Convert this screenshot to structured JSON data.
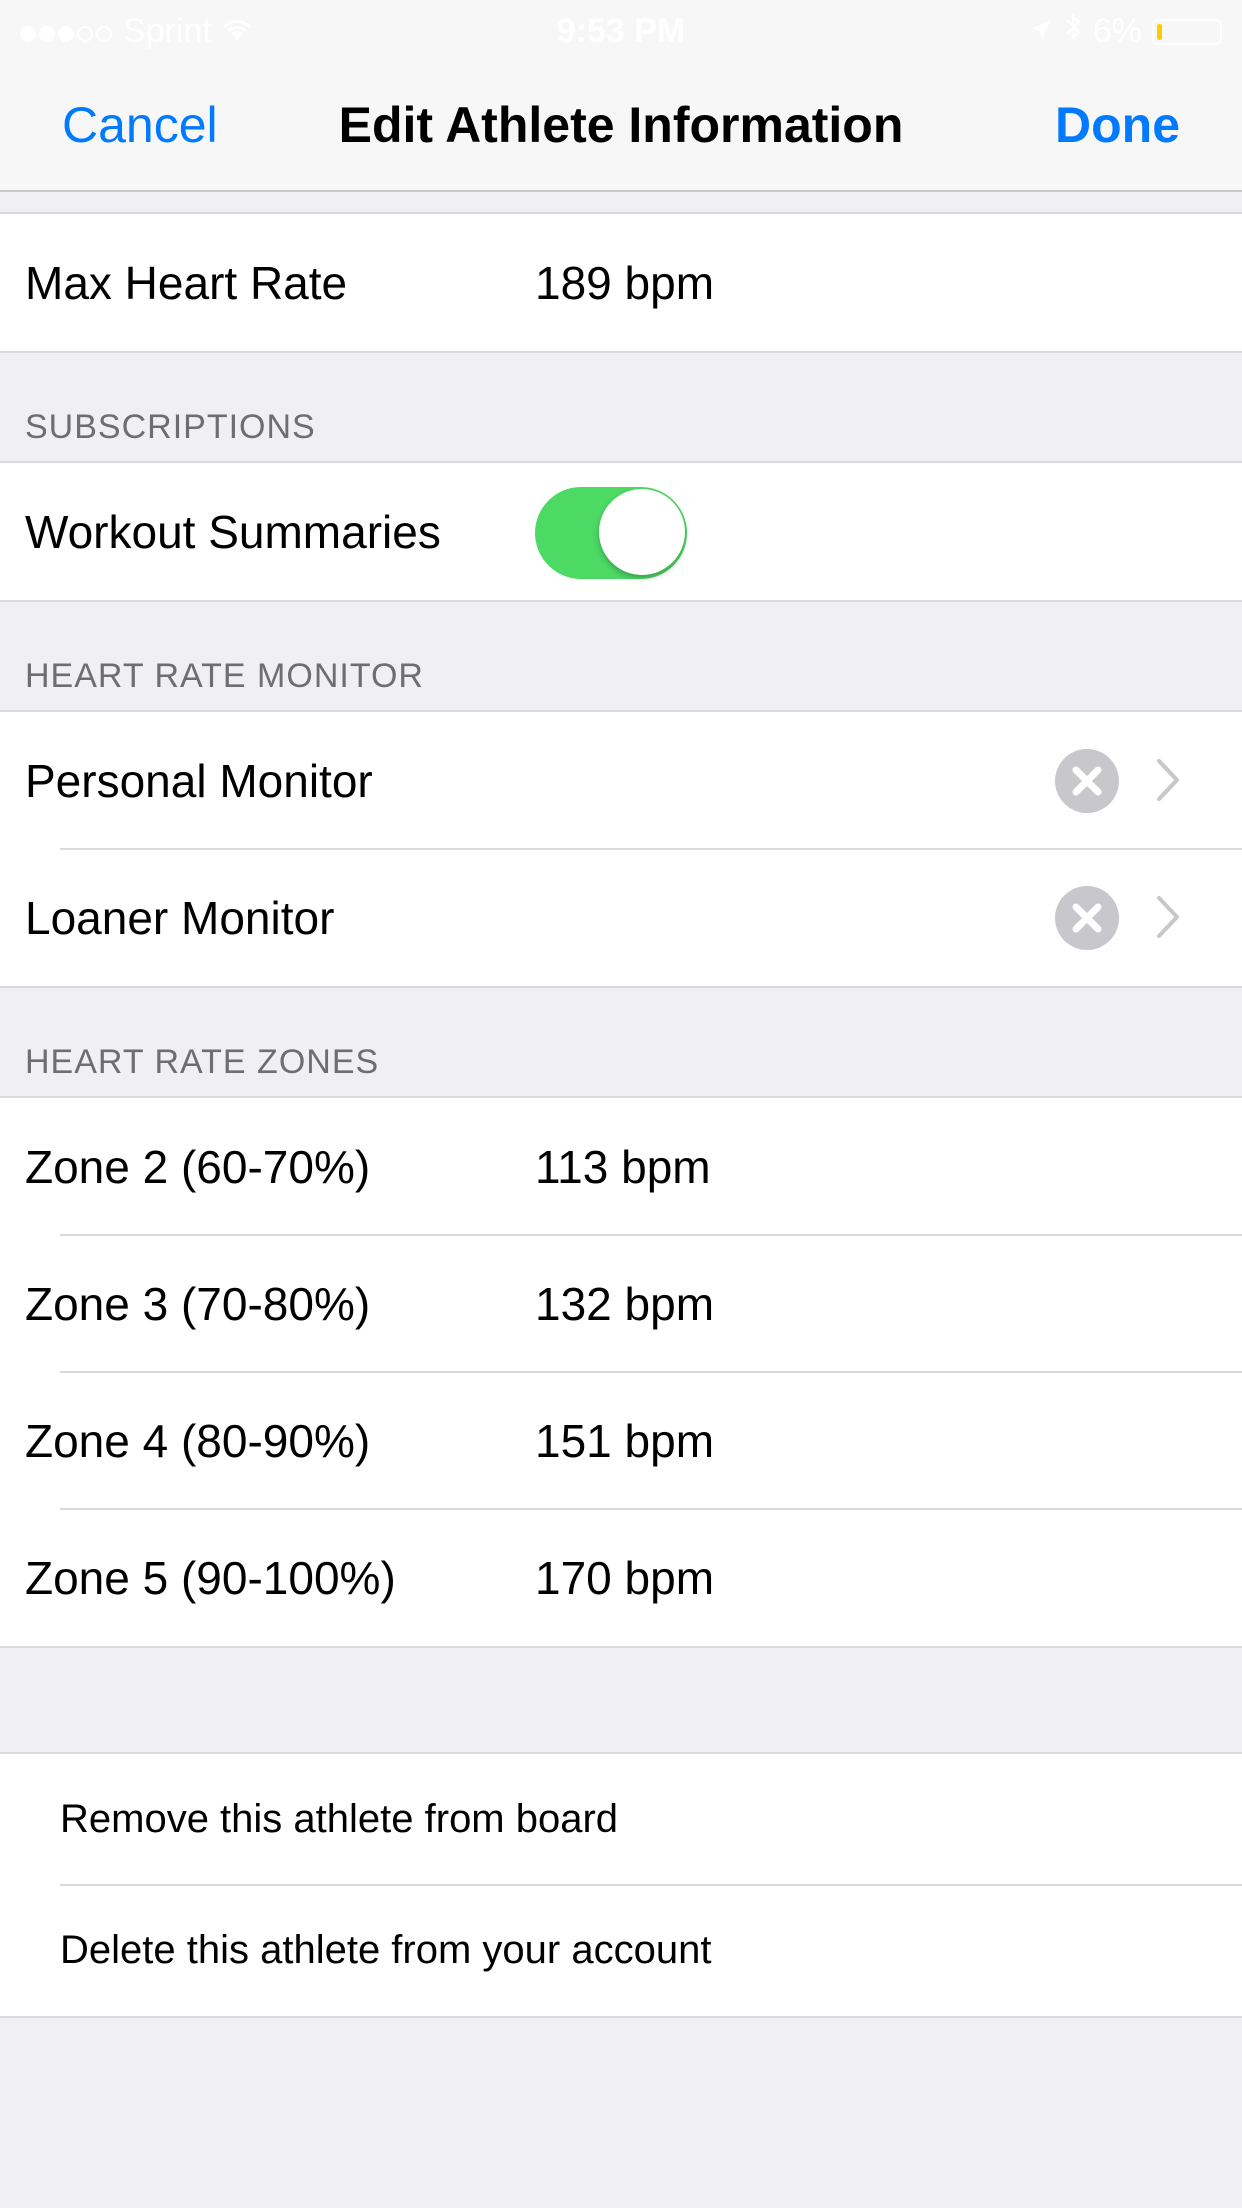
{
  "status_bar": {
    "carrier": "Sprint",
    "time": "9:53 PM",
    "battery": "6%",
    "battery_color": "#ffcc00"
  },
  "nav": {
    "cancel": "Cancel",
    "title": "Edit Athlete Information",
    "done": "Done",
    "accent": "#007aff"
  },
  "max_hr": {
    "label": "Max Heart Rate",
    "value": "189 bpm"
  },
  "subscriptions": {
    "header": "SUBSCRIPTIONS",
    "workout_label": "Workout Summaries",
    "toggle_on": true,
    "toggle_color": "#4cd964"
  },
  "monitor": {
    "header": "HEART RATE MONITOR",
    "personal": "Personal Monitor",
    "loaner": "Loaner Monitor"
  },
  "zones": {
    "header": "HEART RATE ZONES",
    "items": [
      {
        "label": "Zone 2 (60-70%)",
        "value": "113 bpm"
      },
      {
        "label": "Zone 3 (70-80%)",
        "value": "132 bpm"
      },
      {
        "label": "Zone 4 (80-90%)",
        "value": "151 bpm"
      },
      {
        "label": "Zone 5 (90-100%)",
        "value": "170 bpm"
      }
    ]
  },
  "actions": {
    "remove": "Remove this athlete from board",
    "delete": "Delete this athlete from your account"
  },
  "icons": {
    "signal": "signal-dots-icon",
    "wifi": "wifi-icon",
    "location": "location-arrow-icon",
    "bluetooth": "bluetooth-icon",
    "battery": "battery-icon",
    "clear": "clear-x-circle-icon",
    "chevron": "chevron-right-icon"
  }
}
